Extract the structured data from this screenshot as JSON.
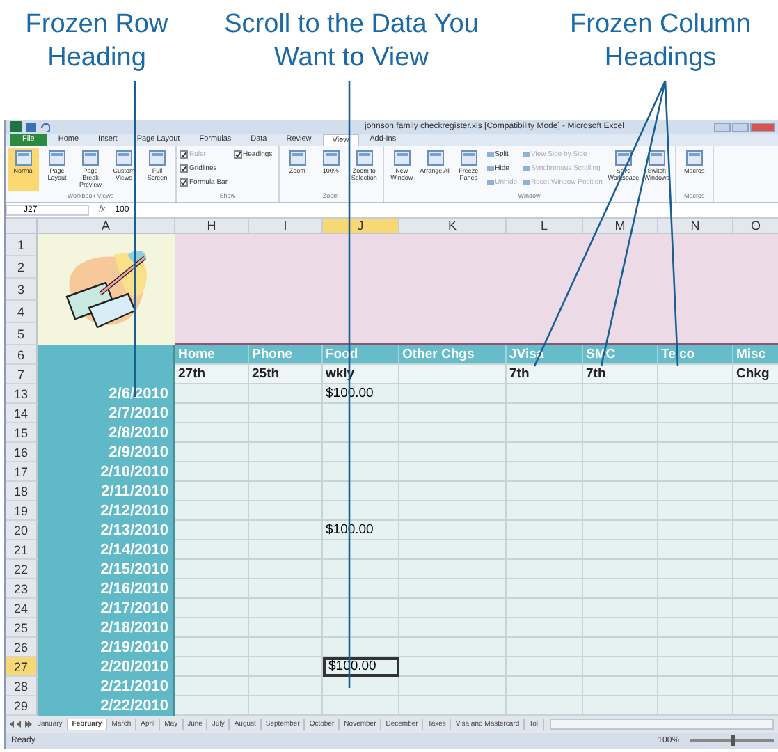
{
  "callouts": [
    {
      "text": "Frozen Row Heading"
    },
    {
      "text": "Scroll to the Data You Want to View"
    },
    {
      "text": "Frozen Column Headings"
    }
  ],
  "window": {
    "title": "johnson family checkregister.xls [Compatibility Mode] - Microsoft Excel"
  },
  "ribbon_tabs": [
    {
      "label": "File",
      "selected": false,
      "kind": "file"
    },
    {
      "label": "Home",
      "selected": false,
      "kind": "tab"
    },
    {
      "label": "Insert",
      "selected": false,
      "kind": "tab"
    },
    {
      "label": "Page Layout",
      "selected": false,
      "kind": "tab"
    },
    {
      "label": "Formulas",
      "selected": false,
      "kind": "tab"
    },
    {
      "label": "Data",
      "selected": false,
      "kind": "tab"
    },
    {
      "label": "Review",
      "selected": false,
      "kind": "tab"
    },
    {
      "label": "View",
      "selected": true,
      "kind": "tab"
    },
    {
      "label": "Add-Ins",
      "selected": false,
      "kind": "tab"
    }
  ],
  "ribbon_groups": [
    {
      "label": "Workbook Views",
      "items": [
        {
          "kind": "big",
          "label": "Normal",
          "selected": true
        },
        {
          "kind": "big",
          "label": "Page Layout",
          "selected": false
        },
        {
          "kind": "big",
          "label": "Page Break Preview",
          "selected": false
        },
        {
          "kind": "big",
          "label": "Custom Views",
          "selected": false
        },
        {
          "kind": "big",
          "label": "Full Screen",
          "selected": false
        }
      ]
    },
    {
      "label": "Show",
      "items": [
        {
          "kind": "check",
          "label": "Ruler",
          "checked": true,
          "disabled": true
        },
        {
          "kind": "check",
          "label": "Gridlines",
          "checked": true,
          "disabled": false
        },
        {
          "kind": "check",
          "label": "Formula Bar",
          "checked": true,
          "disabled": false
        },
        {
          "kind": "check",
          "label": "Headings",
          "checked": true,
          "disabled": false
        }
      ]
    },
    {
      "label": "Zoom",
      "items": [
        {
          "kind": "big",
          "label": "Zoom",
          "selected": false
        },
        {
          "kind": "big",
          "label": "100%",
          "selected": false
        },
        {
          "kind": "big",
          "label": "Zoom to Selection",
          "selected": false
        }
      ]
    },
    {
      "label": "Window",
      "items": [
        {
          "kind": "big",
          "label": "New Window",
          "selected": false
        },
        {
          "kind": "big",
          "label": "Arrange All",
          "selected": false
        },
        {
          "kind": "big",
          "label": "Freeze Panes",
          "selected": false
        },
        {
          "kind": "small",
          "label": "Split",
          "disabled": false
        },
        {
          "kind": "small",
          "label": "Hide",
          "disabled": false
        },
        {
          "kind": "small",
          "label": "Unhide",
          "disabled": true
        },
        {
          "kind": "small",
          "label": "View Side by Side",
          "disabled": true
        },
        {
          "kind": "small",
          "label": "Synchronous Scrolling",
          "disabled": true
        },
        {
          "kind": "small",
          "label": "Reset Window Position",
          "disabled": true
        },
        {
          "kind": "big",
          "label": "Save Workspace",
          "selected": false
        },
        {
          "kind": "big",
          "label": "Switch Windows",
          "selected": false
        }
      ]
    },
    {
      "label": "Macros",
      "items": [
        {
          "kind": "big",
          "label": "Macros",
          "selected": false
        }
      ]
    }
  ],
  "formula_bar": {
    "name_box": "J27",
    "function_label": "fx",
    "formula": "100"
  },
  "columns": [
    {
      "letter": "A",
      "selected": false
    },
    {
      "letter": "H",
      "selected": false
    },
    {
      "letter": "I",
      "selected": false
    },
    {
      "letter": "J",
      "selected": true
    },
    {
      "letter": "K",
      "selected": false
    },
    {
      "letter": "L",
      "selected": false
    },
    {
      "letter": "M",
      "selected": false
    },
    {
      "letter": "N",
      "selected": false
    },
    {
      "letter": "O",
      "selected": false
    }
  ],
  "banner_rows": [
    "1",
    "2",
    "3",
    "4",
    "5"
  ],
  "heading_rows": [
    {
      "number": "6",
      "cells": [
        "Home",
        "Phone",
        "Food",
        "Other Chgs",
        "JVisa",
        "SMC",
        "Telco",
        "Misc"
      ]
    },
    {
      "number": "7",
      "cells": [
        "27th",
        "25th",
        "wkly",
        null,
        "7th",
        "7th",
        null,
        "Chkg"
      ]
    }
  ],
  "rows": [
    {
      "number": "13",
      "selected": false,
      "date": "2/6/2010",
      "cells": [
        null,
        null,
        "$100.00",
        null,
        null,
        null,
        null,
        null
      ]
    },
    {
      "number": "14",
      "selected": false,
      "date": "2/7/2010",
      "cells": [
        null,
        null,
        null,
        null,
        null,
        null,
        null,
        null
      ]
    },
    {
      "number": "15",
      "selected": false,
      "date": "2/8/2010",
      "cells": [
        null,
        null,
        null,
        null,
        null,
        null,
        null,
        null
      ]
    },
    {
      "number": "16",
      "selected": false,
      "date": "2/9/2010",
      "cells": [
        null,
        null,
        null,
        null,
        null,
        null,
        null,
        null
      ]
    },
    {
      "number": "17",
      "selected": false,
      "date": "2/10/2010",
      "cells": [
        null,
        null,
        null,
        null,
        null,
        null,
        null,
        null
      ]
    },
    {
      "number": "18",
      "selected": false,
      "date": "2/11/2010",
      "cells": [
        null,
        null,
        null,
        null,
        null,
        null,
        null,
        null
      ]
    },
    {
      "number": "19",
      "selected": false,
      "date": "2/12/2010",
      "cells": [
        null,
        null,
        null,
        null,
        null,
        null,
        null,
        null
      ]
    },
    {
      "number": "20",
      "selected": false,
      "date": "2/13/2010",
      "cells": [
        null,
        null,
        "$100.00",
        null,
        null,
        null,
        null,
        null
      ]
    },
    {
      "number": "21",
      "selected": false,
      "date": "2/14/2010",
      "cells": [
        null,
        null,
        null,
        null,
        null,
        null,
        null,
        null
      ]
    },
    {
      "number": "22",
      "selected": false,
      "date": "2/15/2010",
      "cells": [
        null,
        null,
        null,
        null,
        null,
        null,
        null,
        null
      ]
    },
    {
      "number": "23",
      "selected": false,
      "date": "2/16/2010",
      "cells": [
        null,
        null,
        null,
        null,
        null,
        null,
        null,
        null
      ]
    },
    {
      "number": "24",
      "selected": false,
      "date": "2/17/2010",
      "cells": [
        null,
        null,
        null,
        null,
        null,
        null,
        null,
        null
      ]
    },
    {
      "number": "25",
      "selected": false,
      "date": "2/18/2010",
      "cells": [
        null,
        null,
        null,
        null,
        null,
        null,
        null,
        null
      ]
    },
    {
      "number": "26",
      "selected": false,
      "date": "2/19/2010",
      "cells": [
        null,
        null,
        null,
        null,
        null,
        null,
        null,
        null
      ]
    },
    {
      "number": "27",
      "selected": true,
      "date": "2/20/2010",
      "cells": [
        null,
        null,
        "$100.00",
        null,
        null,
        null,
        null,
        null
      ]
    },
    {
      "number": "28",
      "selected": false,
      "date": "2/21/2010",
      "cells": [
        null,
        null,
        null,
        null,
        null,
        null,
        null,
        null
      ]
    },
    {
      "number": "29",
      "selected": false,
      "date": "2/22/2010",
      "cells": [
        null,
        null,
        null,
        null,
        null,
        null,
        null,
        null
      ]
    }
  ],
  "sheet_tabs": [
    {
      "label": "January",
      "selected": false
    },
    {
      "label": "February",
      "selected": true
    },
    {
      "label": "March",
      "selected": false
    },
    {
      "label": "April",
      "selected": false
    },
    {
      "label": "May",
      "selected": false
    },
    {
      "label": "June",
      "selected": false
    },
    {
      "label": "July",
      "selected": false
    },
    {
      "label": "August",
      "selected": false
    },
    {
      "label": "September",
      "selected": false
    },
    {
      "label": "October",
      "selected": false
    },
    {
      "label": "November",
      "selected": false
    },
    {
      "label": "December",
      "selected": false
    },
    {
      "label": "Taxes",
      "selected": false
    },
    {
      "label": "Visa and Mastercard",
      "selected": false
    },
    {
      "label": "Tol",
      "selected": false
    }
  ],
  "status_bar": {
    "status": "Ready",
    "zoom": "100%",
    "zoom_slider": {
      "level": 0.5
    }
  }
}
